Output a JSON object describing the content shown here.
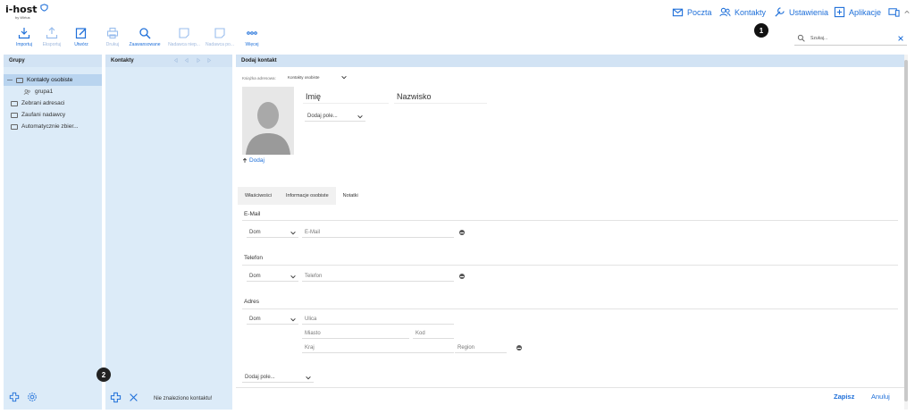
{
  "brand": {
    "logo": "i-host",
    "sub": "by Wirtus"
  },
  "topnav": {
    "poczta": "Poczta",
    "kontakty": "Kontakty",
    "ustawienia": "Ustawienia",
    "aplikacje": "Aplikacje",
    "badge1": "1"
  },
  "toolbar": {
    "importuj": "Importuj",
    "eksportuj": "Eksportuj",
    "utworz": "Utwórz",
    "drukuj": "Drukuj",
    "zaawansowane": "Zaawansowane",
    "nadawca1": "Nadawca niep...",
    "nadawca2": "Nadawca po...",
    "wiecej": "Więcej"
  },
  "search": {
    "placeholder": "Szukaj..."
  },
  "groups": {
    "title": "Grupy",
    "items": [
      "Kontakty osobiste",
      "grupa1",
      "Zebrani adresaci",
      "Zaufani nadawcy",
      "Automatycznie zbier..."
    ]
  },
  "contacts": {
    "title": "Kontakty",
    "empty": "Nie znaleziono kontaktu!",
    "badge2": "2"
  },
  "form": {
    "title": "Dodaj kontakt",
    "addressbook_label": "Książka adresowa:",
    "addressbook_value": "Kontakty osobiste",
    "first_name": "Imię",
    "last_name": "Nazwisko",
    "add_field": "Dodaj pole...",
    "add_photo": "Dodaj",
    "tabs": [
      "Właściwości",
      "Informacje osobiste",
      "Notatki"
    ],
    "email_section": "E-Mail",
    "email_type": "Dom",
    "email_placeholder": "E-Mail",
    "phone_section": "Telefon",
    "phone_type": "Dom",
    "phone_placeholder": "Telefon",
    "address_section": "Adres",
    "address_type": "Dom",
    "street": "Ulica",
    "city": "Miasto",
    "code": "Kod",
    "country": "Kraj",
    "region": "Region",
    "add_field_bottom": "Dodaj pole...",
    "save": "Zapisz",
    "cancel": "Anuluj"
  },
  "colors": {
    "accent": "#1e6fd9",
    "panel": "#dcebf8",
    "panel_header": "#d2e3f4",
    "selected": "#b9d4ef"
  }
}
